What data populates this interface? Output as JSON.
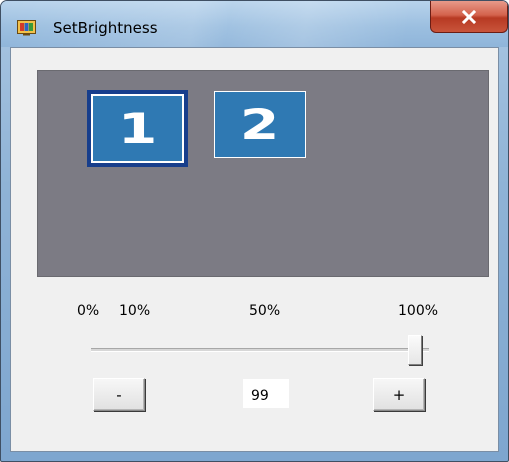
{
  "window": {
    "title": "SetBrightness",
    "icon": "app-monitor-icon",
    "close_icon": "close-icon"
  },
  "monitors": [
    {
      "label": "1",
      "selected": true
    },
    {
      "label": "2",
      "selected": false
    }
  ],
  "scale": {
    "label_0": "0%",
    "label_10": "10%",
    "label_50": "50%",
    "label_100": "100%"
  },
  "brightness": {
    "value": "99",
    "decrement_label": "-",
    "increment_label": "+",
    "slider_percent": 99
  },
  "colors": {
    "monitor_fill": "#2f79b3",
    "selected_border": "#173e8c",
    "monitor_area_bg": "#7c7b84",
    "close_red": "#c9543b"
  }
}
